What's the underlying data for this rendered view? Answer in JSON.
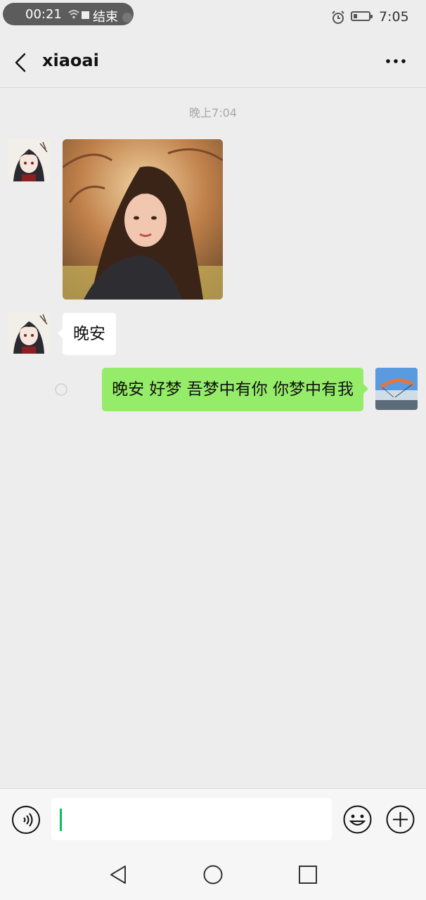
{
  "status_bar": {
    "call_time": "00:21",
    "call_end_label": "结束",
    "clock": "7:05",
    "icons": [
      "wifi-icon",
      "alarm-icon",
      "battery-icon"
    ]
  },
  "header": {
    "title": "xiaoai",
    "back_icon": "back-icon",
    "more_icon": "more-icon"
  },
  "chat": {
    "timestamp": "晚上7:04",
    "messages": [
      {
        "sender": "xiaoai",
        "type": "image",
        "description_icon": "photo-message"
      },
      {
        "sender": "xiaoai",
        "type": "text",
        "text": "晚安"
      },
      {
        "sender": "me",
        "type": "text",
        "text": "晚安 好梦  吾梦中有你 你梦中有我",
        "status": "sending"
      }
    ]
  },
  "input_bar": {
    "value": "",
    "icons": [
      "voice-icon",
      "emoji-icon",
      "plus-icon"
    ]
  },
  "colors": {
    "background": "#ededed",
    "my_bubble": "#95ec69",
    "their_bubble": "#ffffff",
    "caret": "#07c160"
  }
}
